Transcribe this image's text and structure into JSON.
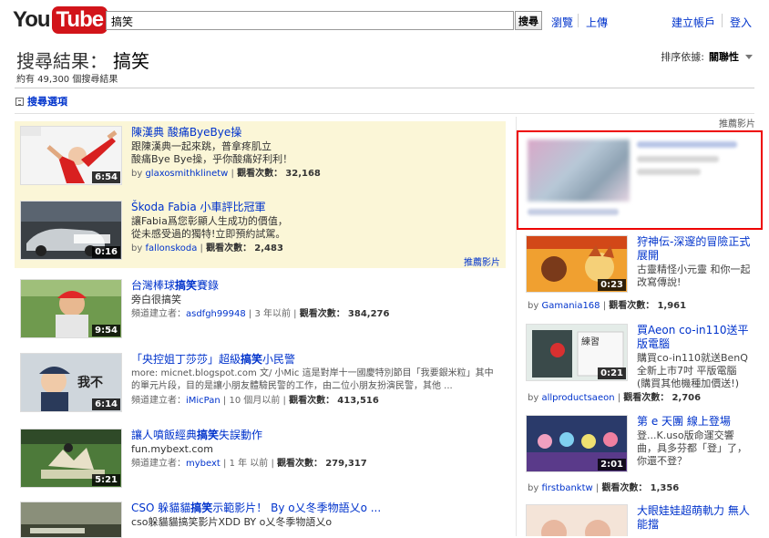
{
  "header": {
    "logo_you": "You",
    "logo_tube": "Tube",
    "search_value": "搞笑",
    "search_button": "搜尋",
    "browse": "瀏覽",
    "upload": "上傳",
    "create_account": "建立帳戶",
    "login": "登入"
  },
  "results": {
    "title": "搜尋結果：",
    "query": "搞笑",
    "count": "約有 49,300 個搜尋結果",
    "sort_label": "排序依據:",
    "sort_value": "關聯性",
    "search_options": "搜尋選項",
    "promoted_label": "推薦影片"
  },
  "promoted": [
    {
      "title": "陳漢典 酸痛ByeBye操",
      "desc1": "跟陳漢典一起來跳，普拿疼肌立",
      "desc2": "酸痛Bye Bye操，乎你酸痛好利利！",
      "by": "by",
      "user": "glaxosmithklinetw",
      "views_label": "觀看次數：",
      "views": "32,168",
      "duration": "6:54"
    },
    {
      "title": "Škoda Fabia 小車評比冠軍",
      "desc1": "讓Fabia爲您彰顯人生成功的價值，",
      "desc2": "從未感受過的獨特!立即預約試駕。",
      "by": "by",
      "user": "fallonskoda",
      "views_label": "觀看次數：",
      "views": "2,483",
      "duration": "0:16"
    }
  ],
  "videos": [
    {
      "title_pre": "台灣棒球",
      "title_hl": "搞笑",
      "title_post": "賽錄",
      "desc": "旁白很搞笑",
      "uploader_label": "頻道建立者：",
      "user": "asdfgh99948",
      "age": "3 年以前",
      "views_label": "觀看次數：",
      "views": "384,276",
      "duration": "9:54"
    },
    {
      "title_pre": "「央控姐丁莎莎」超級",
      "title_hl": "搞笑",
      "title_post": "小民警",
      "desc": "more: micnet.blogspot.com 文/ 小Mic 這是對岸十一國慶特別節目「我要銀米粒」其中的單元片段，目的是讓小朋友體驗民警的工作，由二位小朋友扮演民警，其他 ...",
      "uploader_label": "頻道建立者：",
      "user": "iMicPan",
      "age": "10 個月以前",
      "views_label": "觀看次數：",
      "views": "413,516",
      "duration": "6:14"
    },
    {
      "title_pre": "讓人噴飯經典",
      "title_hl": "搞笑",
      "title_post": "失誤動作",
      "desc": "fun.mybext.com",
      "uploader_label": "頻道建立者：",
      "user": "mybext",
      "age": "1 年 以前",
      "views_label": "觀看次數：",
      "views": "279,317",
      "duration": "5:21"
    },
    {
      "title_pre": "CSO 躲貓貓",
      "title_hl": "搞笑",
      "title_post": "示範影片！ By o乂冬季物語乂o ...",
      "desc": "cso躲貓貓搞笑影片XDD BY o乂冬季物語乂o"
    }
  ],
  "recommended": {
    "label": "推薦影片",
    "items": [
      {
        "title": "狩神伝-深邃的冒險正式展開",
        "desc": "古靈精怪小元靈 和你一起改寫傳說!",
        "by": "by",
        "user": "Gamania168",
        "views_label": "觀看次數：",
        "views": "1,961",
        "duration": "0:23"
      },
      {
        "title": "買Aeon co-in110送平版電腦",
        "desc": "購買co-in110就送BenQ全新上市7吋 平版電腦 (購買其他機種加價送!)",
        "by": "by",
        "user": "allproductsaeon",
        "views_label": "觀看次數：",
        "views": "2,706",
        "duration": "0:21"
      },
      {
        "title": "第 e 天團 線上登場",
        "desc": "登...K.uso版命運交響曲，具多芬都「登」了，你還不登？",
        "by": "by",
        "user": "firstbanktw",
        "views_label": "觀看次數：",
        "views": "1,356",
        "duration": "2:01"
      },
      {
        "title": "大眼娃娃超萌軌力 無人能擋"
      }
    ]
  },
  "colors": {
    "accent": "#0033cc",
    "logo_red": "#d2141a",
    "promo_bg": "#fbf6d7",
    "ad_border": "#ee0000"
  }
}
